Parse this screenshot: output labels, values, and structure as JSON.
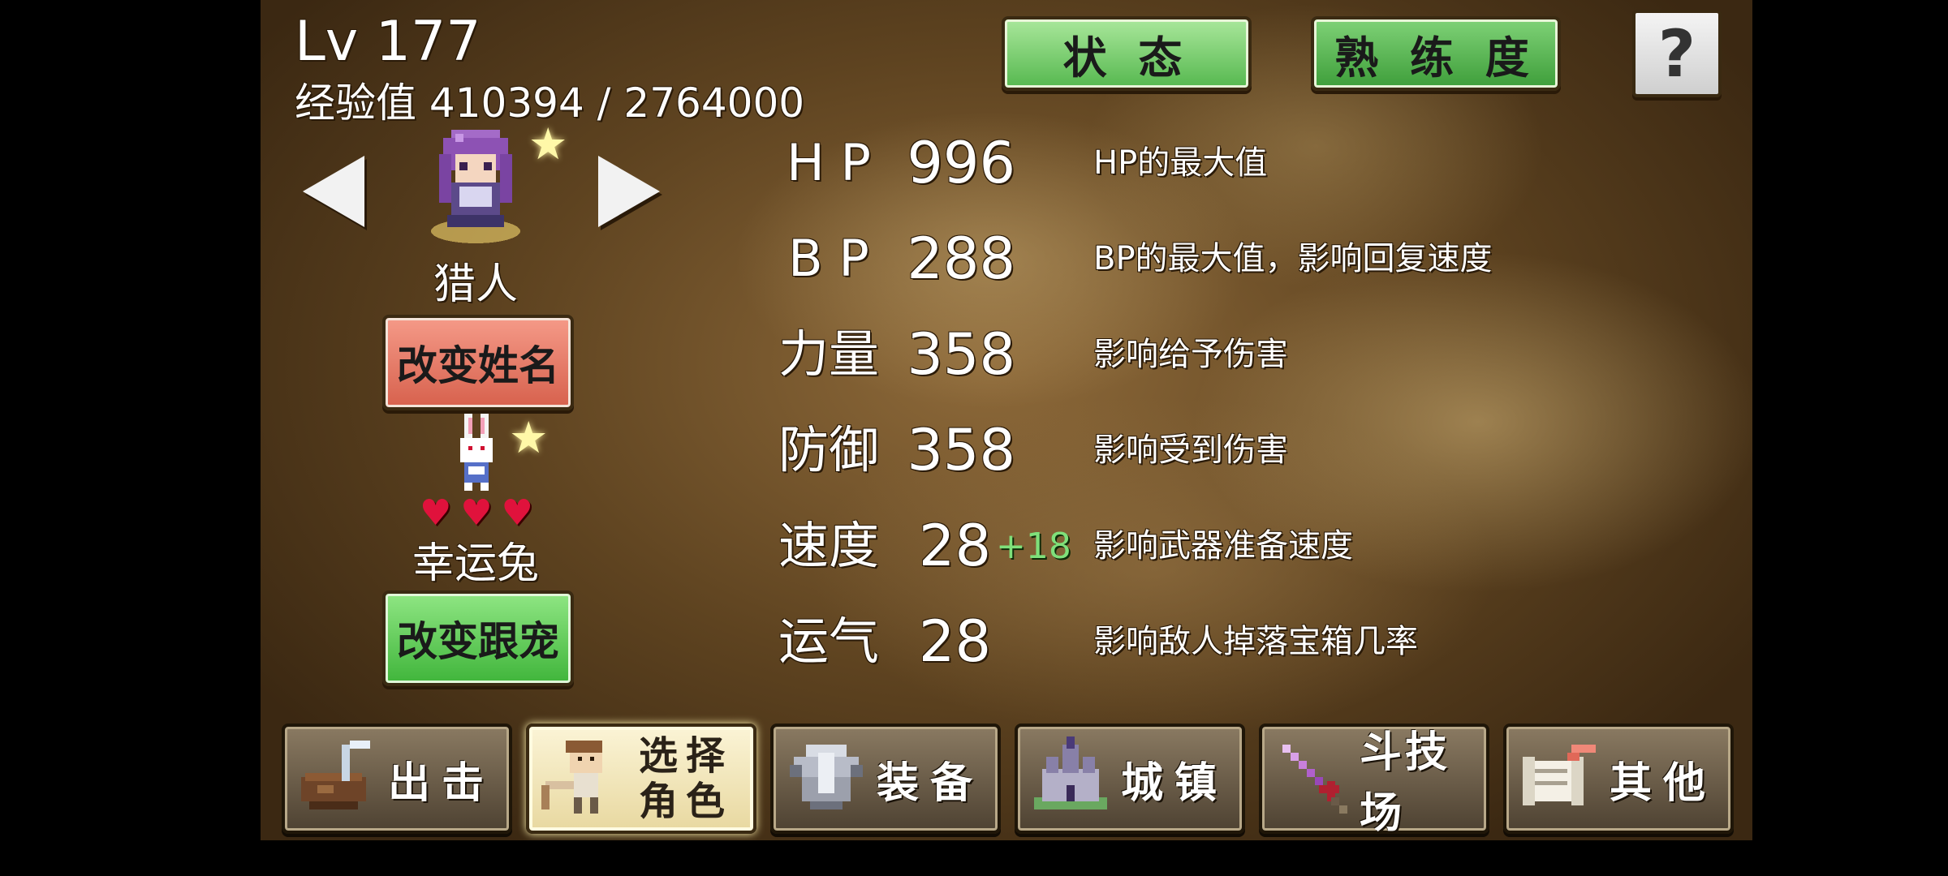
{
  "header": {
    "level": "Lv 177",
    "exp": "经验值 410394 / 2764000"
  },
  "top_tabs": {
    "status": "状 态",
    "proficiency": "熟 练 度",
    "help": "?"
  },
  "character": {
    "name": "猎人",
    "rename_button": "改变姓名"
  },
  "pet": {
    "name": "幸运兔",
    "hearts": 3,
    "change_button": "改变跟宠"
  },
  "stats": [
    {
      "label": "H P",
      "value": "996",
      "bonus": "",
      "desc": "HP的最大值"
    },
    {
      "label": "B P",
      "value": "288",
      "bonus": "",
      "desc": "BP的最大值，影响回复速度"
    },
    {
      "label": "力量",
      "value": "358",
      "bonus": "",
      "desc": "影响给予伤害"
    },
    {
      "label": "防御",
      "value": "358",
      "bonus": "",
      "desc": "影响受到伤害"
    },
    {
      "label": "速度",
      "value": "28",
      "bonus": "+18",
      "desc": "影响武器准备速度"
    },
    {
      "label": "运气",
      "value": "28",
      "bonus": "",
      "desc": "影响敌人掉落宝箱几率"
    }
  ],
  "bottom_nav": [
    {
      "label": "出击",
      "icon": "pot-icon",
      "active": false
    },
    {
      "label": "选择角色",
      "icon": "character-select-icon",
      "active": true
    },
    {
      "label": "装备",
      "icon": "armor-icon",
      "active": false
    },
    {
      "label": "城镇",
      "icon": "castle-icon",
      "active": false
    },
    {
      "label": "斗技场",
      "icon": "sword-icon",
      "active": false
    },
    {
      "label": "其他",
      "icon": "scroll-icon",
      "active": false
    }
  ],
  "colors": {
    "button_green": "#56b84f",
    "button_red": "#d7614d",
    "bonus_green": "#7fe07a",
    "heart_red": "#e0123c"
  }
}
